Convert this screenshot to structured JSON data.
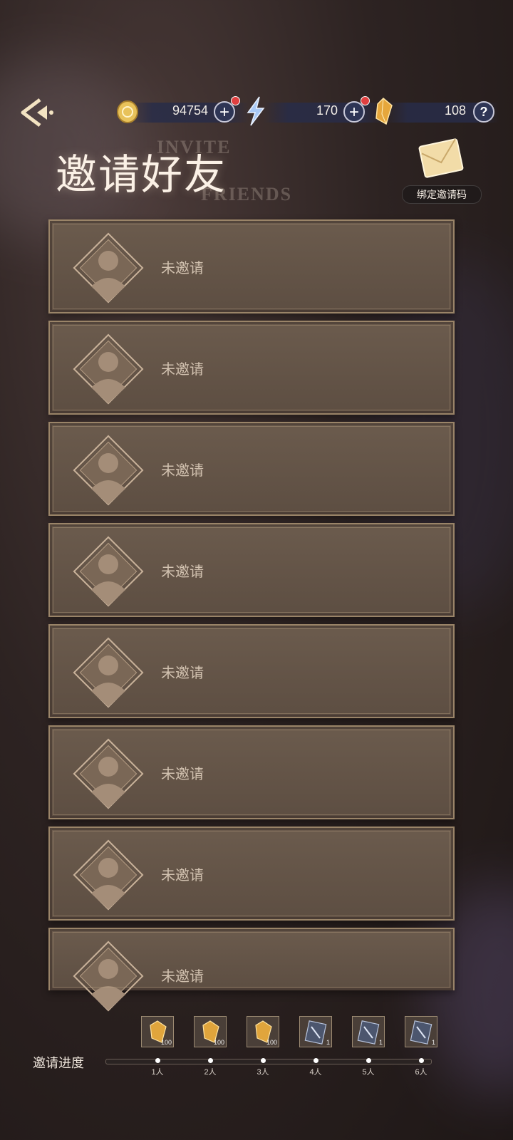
{
  "topbar": {
    "gold": "94754",
    "energy": "170",
    "crystal": "108",
    "help": "?"
  },
  "title": {
    "cn": "邀请好友",
    "en1": "INVITE",
    "en2": "FRIENDS"
  },
  "bind_button": {
    "label": "绑定邀请码"
  },
  "friend_slots": [
    {
      "status": "未邀请"
    },
    {
      "status": "未邀请"
    },
    {
      "status": "未邀请"
    },
    {
      "status": "未邀请"
    },
    {
      "status": "未邀请"
    },
    {
      "status": "未邀请"
    },
    {
      "status": "未邀请"
    },
    {
      "status": "未邀请"
    }
  ],
  "progress": {
    "label": "邀请进度",
    "milestones": [
      {
        "label": "1人",
        "reward_icon": "crystal-icon",
        "count": "100"
      },
      {
        "label": "2人",
        "reward_icon": "crystal-icon",
        "count": "100"
      },
      {
        "label": "3人",
        "reward_icon": "crystal-icon",
        "count": "100"
      },
      {
        "label": "4人",
        "reward_icon": "card-icon",
        "count": "1"
      },
      {
        "label": "5人",
        "reward_icon": "card-icon",
        "count": "1"
      },
      {
        "label": "6人",
        "reward_icon": "card-icon",
        "count": "1"
      }
    ]
  },
  "colors": {
    "card": "#5d4e42",
    "border": "#9a8468",
    "accent_red": "#e04040"
  }
}
